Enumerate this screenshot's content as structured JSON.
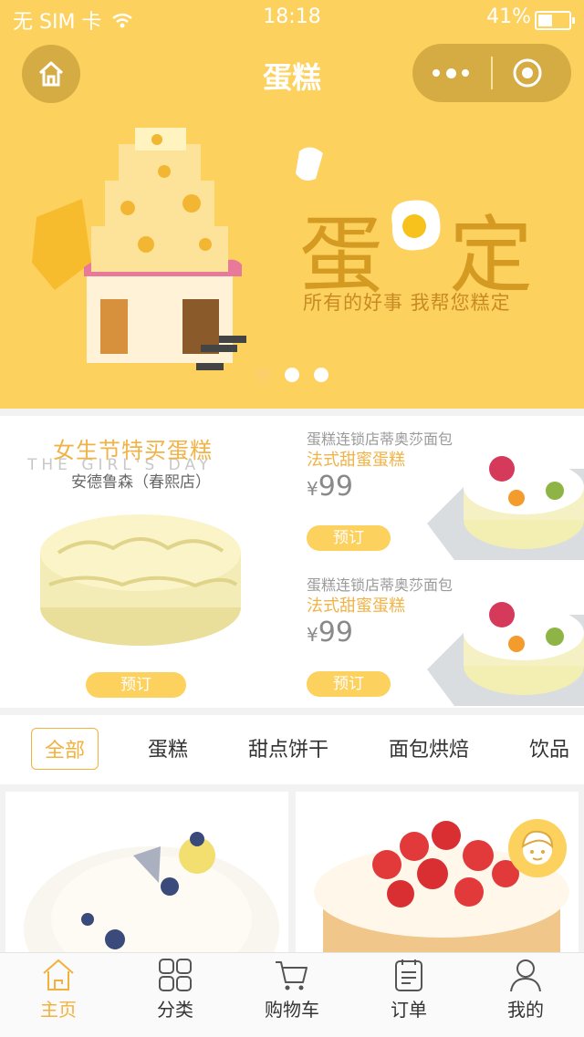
{
  "status_bar": {
    "carrier": "无 SIM 卡",
    "time": "18:18",
    "battery": "41%",
    "battery_level": 0.41
  },
  "nav": {
    "title": "蛋糕"
  },
  "banner": {
    "title_left": "蛋",
    "title_right": "定",
    "subtitle": "所有的好事 我帮您糕定",
    "pages": 3,
    "active_page": 0
  },
  "promo": {
    "left": {
      "title": "女生节特买蛋糕",
      "subtitle_en": "THE GIRL'S DAY",
      "store": "安德鲁森（春熙店）",
      "button": "预订"
    },
    "items": [
      {
        "shop": "蛋糕连锁店蒂奥莎面包",
        "name": "法式甜蜜蛋糕",
        "currency": "¥",
        "price": "99",
        "button": "预订"
      },
      {
        "shop": "蛋糕连锁店蒂奥莎面包",
        "name": "法式甜蜜蛋糕",
        "currency": "¥",
        "price": "99",
        "button": "预订"
      }
    ]
  },
  "categories": [
    "全部",
    "蛋糕",
    "甜点饼干",
    "面包烘焙",
    "饮品"
  ],
  "tabbar": [
    "主页",
    "分类",
    "购物车",
    "订单",
    "我的"
  ],
  "colors": {
    "accent": "#fdd15e",
    "active": "#f2b13d",
    "capsule": "#d5ab44"
  }
}
